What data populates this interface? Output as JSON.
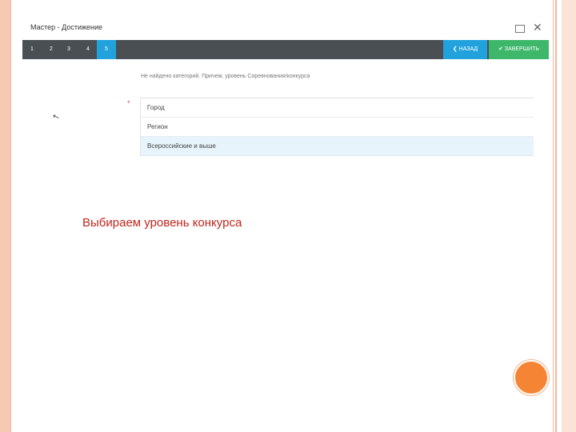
{
  "window": {
    "title": "Мастер - Достижение",
    "maximize_icon": "maximize-icon",
    "close_label": "✕"
  },
  "steps": [
    "1",
    "2",
    "3",
    "4",
    "5"
  ],
  "active_step": "5",
  "buttons": {
    "back_label": "❮ НАЗАД",
    "finish_label": "✔ ЗАВЕРШИТЬ"
  },
  "question": "Не найдено категорий. Причем, уровень Соревнования/конкурса",
  "required_mark": "*",
  "options": [
    {
      "label": "Город",
      "selected": false
    },
    {
      "label": "Регион",
      "selected": false
    },
    {
      "label": "Всероссийские и выше",
      "selected": true
    }
  ],
  "caption": "Выбираем уровень конкурса",
  "colors": {
    "step_bar": "#4a4f54",
    "active_step": "#22a2dc",
    "finish": "#3fb76a",
    "caption": "#c0261d",
    "circle": "#f58534"
  }
}
